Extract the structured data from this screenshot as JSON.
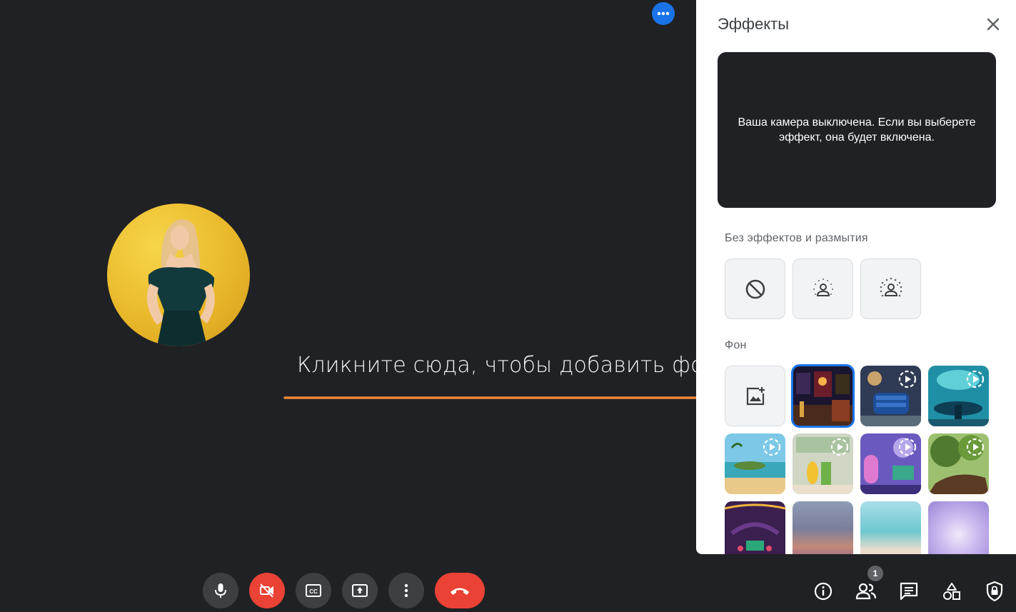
{
  "stage": {
    "annotation": "Кликните сюда, чтобы добавить фон"
  },
  "controls": {
    "left": [
      "mic-icon",
      "camera-off-icon",
      "captions-icon",
      "present-icon",
      "more-vert-icon",
      "hang-up-icon"
    ],
    "right": [
      "info-icon",
      "people-icon",
      "chat-icon",
      "activities-icon",
      "lock-icon"
    ],
    "people_count": "1"
  },
  "panel": {
    "title": "Эффекты",
    "preview_text": "Ваша камера выключена. Если вы выберете эффект, она будет включена.",
    "section_blur": "Без эффектов и размытия",
    "section_background": "Фон"
  },
  "colors": {
    "accent_blue": "#1a73e8",
    "danger_red": "#ea4335",
    "annotation_orange": "#f0883e",
    "stage_bg": "#202124"
  }
}
